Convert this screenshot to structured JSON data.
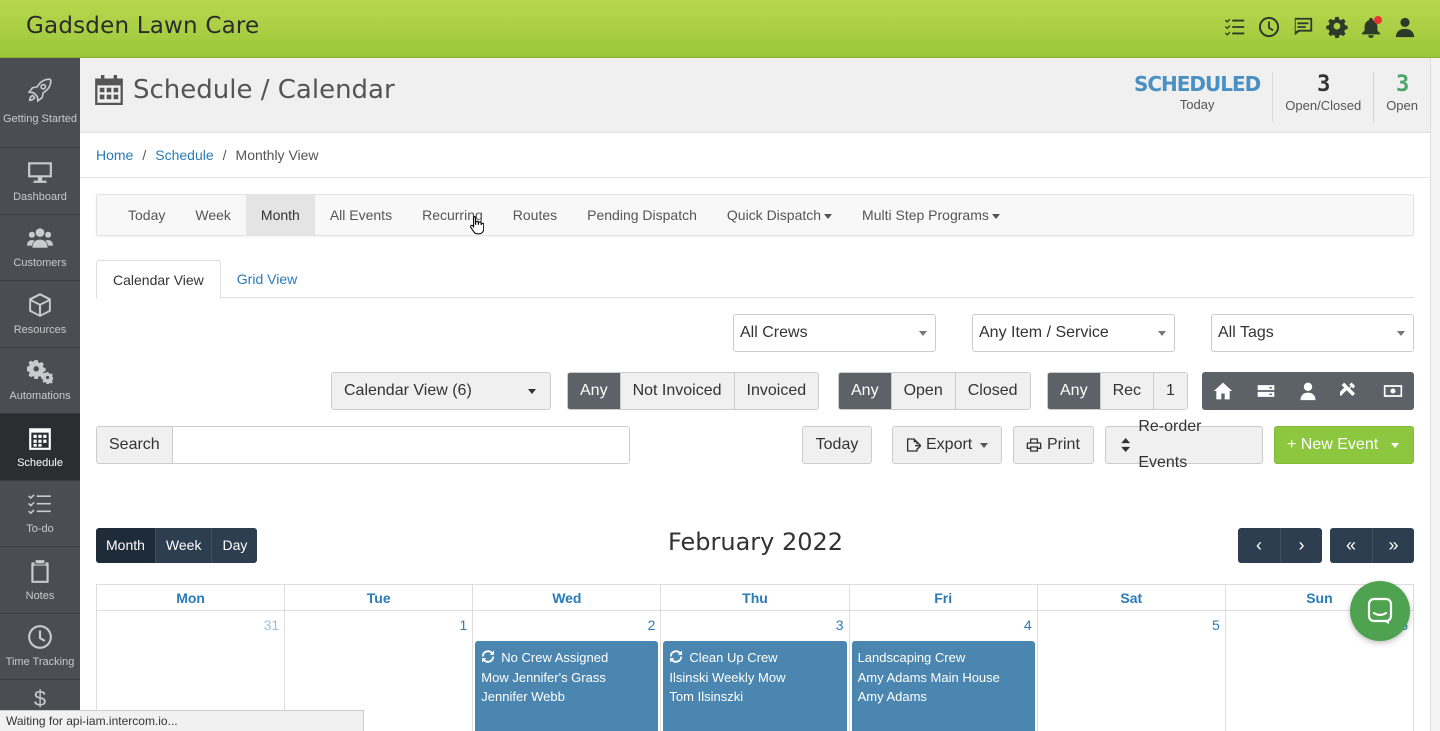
{
  "app": {
    "brand": "Gadsden Lawn Care"
  },
  "topbar": {
    "icons": [
      "tasks-icon",
      "clock-icon",
      "chat-icon",
      "gear-icon",
      "bell-icon",
      "user-icon"
    ]
  },
  "sidebar": {
    "items": [
      {
        "label": "Getting Started",
        "icon": "rocket-icon"
      },
      {
        "label": "Dashboard",
        "icon": "monitor-icon"
      },
      {
        "label": "Customers",
        "icon": "users-icon"
      },
      {
        "label": "Resources",
        "icon": "box-icon"
      },
      {
        "label": "Automations",
        "icon": "cogs-icon"
      },
      {
        "label": "Schedule",
        "icon": "calendar-icon"
      },
      {
        "label": "To-do",
        "icon": "list-icon"
      },
      {
        "label": "Notes",
        "icon": "clipboard-icon"
      },
      {
        "label": "Time Tracking",
        "icon": "clock-icon"
      },
      {
        "label": "$",
        "icon": "dollar-icon"
      }
    ]
  },
  "header": {
    "title": "Schedule / Calendar",
    "stats": [
      {
        "value": "SCHEDULED",
        "label": "Today"
      },
      {
        "value": "3",
        "label": "Open/Closed"
      },
      {
        "value": "3",
        "label": "Open"
      }
    ]
  },
  "breadcrumb": {
    "home": "Home",
    "schedule": "Schedule",
    "current": "Monthly View"
  },
  "nav": {
    "items": [
      "Today",
      "Week",
      "Month",
      "All Events",
      "Recurring",
      "Routes",
      "Pending Dispatch",
      "Quick Dispatch",
      "Multi Step Programs"
    ]
  },
  "tabs": {
    "calendar": "Calendar View",
    "grid": "Grid View"
  },
  "filters": {
    "crews": "All Crews",
    "items": "Any Item / Service",
    "tags": "All Tags",
    "view": "Calendar View (6)",
    "invoice": [
      "Any",
      "Not Invoiced",
      "Invoiced"
    ],
    "status": [
      "Any",
      "Open",
      "Closed"
    ],
    "recurring": [
      "Any",
      "Rec",
      "1"
    ]
  },
  "search": {
    "label": "Search",
    "value": ""
  },
  "actions": {
    "today": "Today",
    "export": "Export",
    "print": "Print",
    "reorder": "Re-order Events",
    "new_event": "+ New Event"
  },
  "calendar": {
    "views": [
      "Month",
      "Week",
      "Day"
    ],
    "title": "February 2022",
    "nav": [
      "‹",
      "›",
      "«",
      "»"
    ],
    "weekdays": [
      "Mon",
      "Tue",
      "Wed",
      "Thu",
      "Fri",
      "Sat",
      "Sun"
    ],
    "days": [
      "31",
      "1",
      "2",
      "3",
      "4",
      "5",
      "6"
    ],
    "events": [
      {
        "day": 2,
        "crew": "No Crew Assigned",
        "title": "Mow Jennifer's Grass",
        "customer": "Jennifer Webb",
        "recurring": true
      },
      {
        "day": 3,
        "crew": "Clean Up Crew",
        "title": "Ilsinski Weekly Mow",
        "customer": "Tom Ilsinszki",
        "recurring": true
      },
      {
        "day": 4,
        "crew": "Landscaping Crew",
        "title": "Amy Adams Main House",
        "customer": "Amy Adams",
        "recurring": false
      }
    ]
  },
  "statusbar": {
    "text": "Waiting for api-iam.intercom.io..."
  },
  "colors": {
    "accent_green": "#8dc63f",
    "link_blue": "#2a7ab8",
    "event_blue": "#4a86b0",
    "dark_nav": "#2c3e50"
  }
}
